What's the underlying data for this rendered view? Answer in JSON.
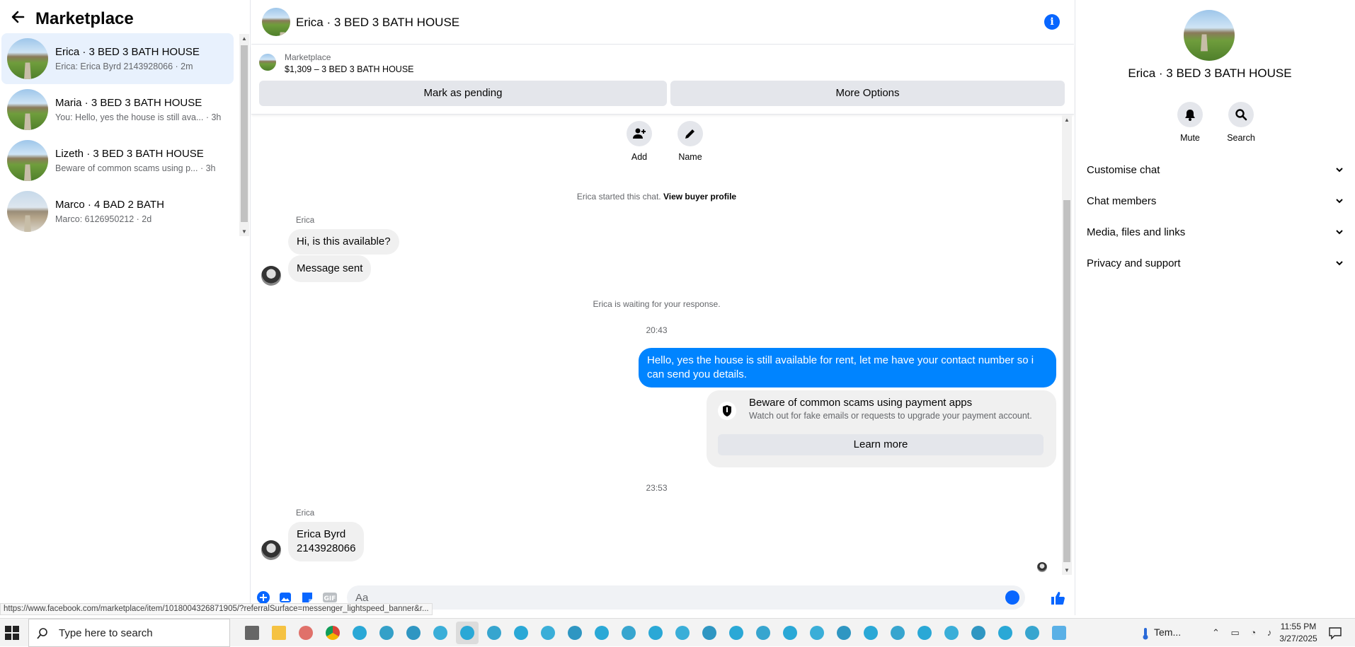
{
  "left": {
    "title": "Marketplace",
    "conversations": [
      {
        "name": "Erica · 3 BED 3 BATH HOUSE",
        "preview": "Erica: Erica Byrd 2143928066 · 2m",
        "active": true
      },
      {
        "name": "Maria · 3 BED 3 BATH HOUSE",
        "preview": "You: Hello, yes the house is still ava... · 3h",
        "active": false
      },
      {
        "name": "Lizeth · 3 BED 3 BATH HOUSE",
        "preview": "Beware of common scams using p... · 3h",
        "active": false
      },
      {
        "name": "Marco · 4 BAD 2 BATH",
        "preview": "Marco: 6126950212 · 2d",
        "active": false
      }
    ]
  },
  "header": {
    "name": "Erica · 3 BED 3 BATH HOUSE"
  },
  "listing": {
    "label": "Marketplace",
    "price": "$1,309 – 3 BED 3 BATH HOUSE",
    "pending_button": "Mark as pending",
    "more_button": "More Options"
  },
  "chat_actions": {
    "add": "Add",
    "name": "Name"
  },
  "messages": {
    "started": "Erica started this chat.",
    "view_profile": "View buyer profile",
    "sender1": "Erica",
    "msg1": "Hi, is this available?",
    "msg2": "Message sent",
    "waiting": "Erica is waiting for your response.",
    "time1": "20:43",
    "outgoing": "Hello, yes the house is still available for rent, let me have your contact number so i can send you details.",
    "warn_title": "Beware of common scams using payment apps",
    "warn_sub": "Watch out for fake emails or requests to upgrade your payment account.",
    "learn_more": "Learn more",
    "time2": "23:53",
    "sender2": "Erica",
    "reply": "Erica Byrd\n2143928066"
  },
  "compose": {
    "placeholder": "Aa"
  },
  "status_url": "https://www.facebook.com/marketplace/item/1018004326871905/?referralSurface=messenger_lightspeed_banner&r...",
  "right": {
    "name": "Erica · 3 BED 3 BATH HOUSE",
    "mute": "Mute",
    "search": "Search",
    "sections": [
      "Customise chat",
      "Chat members",
      "Media, files and links",
      "Privacy and support"
    ]
  },
  "taskbar": {
    "search_placeholder": "Type here to search",
    "weather": "Tem...",
    "time": "11:55 PM",
    "date": "3/27/2025"
  },
  "colors": {
    "accent": "#0866ff",
    "outgoing_bubble": "#0084ff",
    "active_row": "#e8f1fd"
  }
}
